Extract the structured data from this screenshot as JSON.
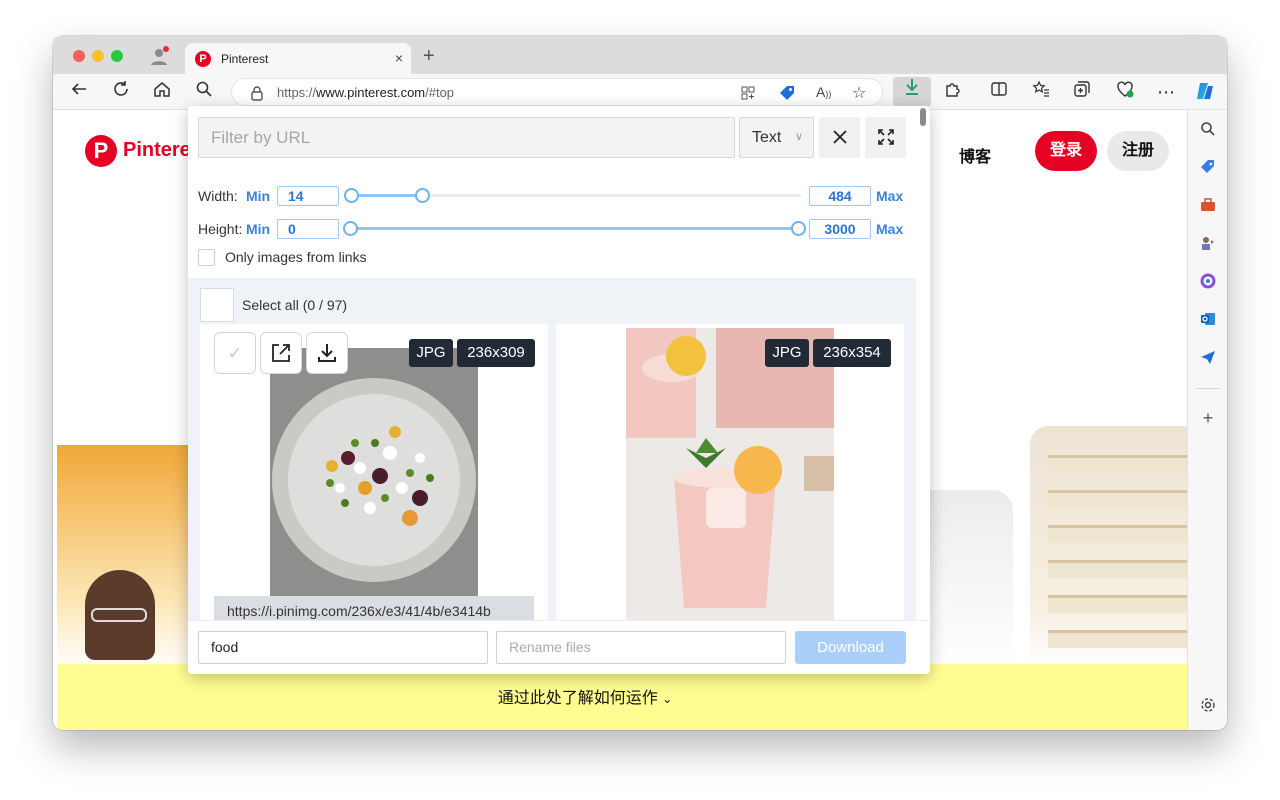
{
  "browser": {
    "tab_title": "Pinterest",
    "tab_close": "×",
    "new_tab": "+",
    "url_scheme": "https://",
    "url_host": "www.pinterest.com",
    "url_path": "/#top"
  },
  "page": {
    "logo_letter": "P",
    "brand": "Pinterest",
    "blog": "博客",
    "login": "登录",
    "signup": "注册",
    "banner": "通过此处了解如何运作"
  },
  "popup": {
    "filter_placeholder": "Filter by URL",
    "mode_value": "Text",
    "width_label": "Width:",
    "height_label": "Height:",
    "min_label": "Min",
    "max_label": "Max",
    "width_min": "14",
    "width_max": "484",
    "height_min": "0",
    "height_max": "3000",
    "width_slider": {
      "low_fraction": 0.0,
      "high_fraction": 0.16
    },
    "height_slider": {
      "low_fraction": 0.0,
      "high_fraction": 1.0
    },
    "only_links_label": "Only images from links",
    "select_all": "Select all (0 / 97)",
    "images": [
      {
        "format": "JPG",
        "size": "236x309",
        "url": "https://i.pinimg.com/236x/e3/41/4b/e3414b"
      },
      {
        "format": "JPG",
        "size": "236x354"
      }
    ],
    "subfolder_value": "food",
    "rename_placeholder": "Rename files",
    "download_label": "Download"
  },
  "colors": {
    "pinterest_red": "#e60023",
    "accent_blue": "#3a82d8",
    "banner_yellow": "#fffd92"
  }
}
